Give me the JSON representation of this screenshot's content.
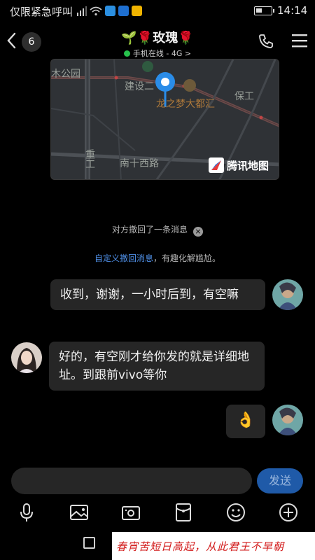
{
  "status_bar": {
    "carrier": "仅限紧急呼叫",
    "time": "14:14"
  },
  "header": {
    "unread_count": "6",
    "title": "🌱🌹玫瑰🌹",
    "subtitle_status": "手机在线 - 4G",
    "subtitle_arrow": ">"
  },
  "map": {
    "labels": {
      "park": "木公园",
      "road1": "建设二",
      "poi": "龙之梦大都汇",
      "baogong": "保工",
      "zhonggong": "重工",
      "nanshixi": "南十西路"
    },
    "logo_text": "腾讯地图"
  },
  "notices": {
    "recall": "对方撤回了一条消息",
    "recall_close": "×",
    "custom_link": "自定义撤回消息",
    "custom_tail": "，有趣化解尴尬。"
  },
  "messages": [
    {
      "side": "right",
      "text": "收到，谢谢，一小时后到，有空嘛"
    },
    {
      "side": "left",
      "text": "好的，有空刚才给你发的就是详细地址。到跟前vivo等你"
    },
    {
      "side": "right",
      "text": "👌"
    }
  ],
  "input": {
    "send_label": "发送"
  },
  "banner": {
    "text": "春宵苦短日高起，从此君王不早朝"
  },
  "colors": {
    "accent": "#1f5aa8",
    "online": "#27c24c",
    "link": "#4f8fe6",
    "bubble": "#262626"
  }
}
